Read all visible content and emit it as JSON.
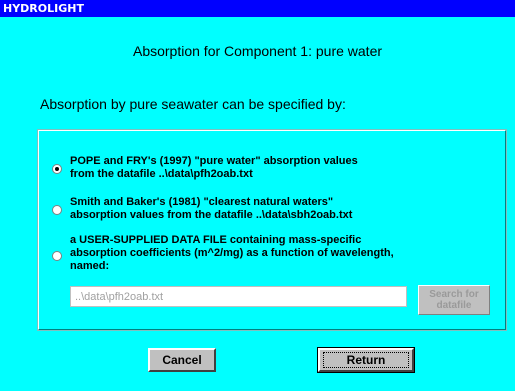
{
  "window": {
    "title": "HYDROLIGHT"
  },
  "heading": "Absorption for Component 1:  pure water",
  "intro": "Absorption by pure seawater can be specified by:",
  "options": [
    {
      "lines": [
        "POPE and  FRY's (1997) \"pure water\" absorption values",
        "from the datafile ..\\data\\pfh2oab.txt"
      ],
      "selected": true
    },
    {
      "lines": [
        "Smith and Baker's (1981) \"clearest natural waters\"",
        "absorption values from the datafile ..\\data\\sbh2oab.txt"
      ],
      "selected": false
    },
    {
      "lines": [
        "a USER-SUPPLIED DATA FILE containing mass-specific",
        "absorption coefficients (m^2/mg) as a function of wavelength,",
        "named:"
      ],
      "selected": false
    }
  ],
  "datafile_input": {
    "value": "..\\data\\pfh2oab.txt"
  },
  "search_button": {
    "line1": "Search for",
    "line2": "datafile"
  },
  "buttons": {
    "cancel": "Cancel",
    "return": "Return"
  }
}
